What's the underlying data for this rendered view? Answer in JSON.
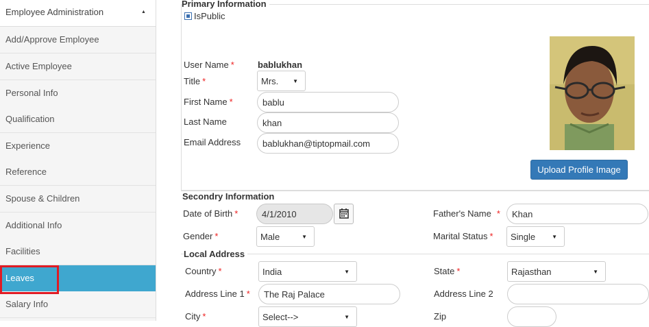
{
  "sidebar": {
    "header": "Employee Administration",
    "items": [
      {
        "label": "Add/Approve Employee"
      },
      {
        "label": "Active Employee"
      },
      {
        "label": "Personal Info"
      },
      {
        "label": "Qualification"
      },
      {
        "label": "Experience"
      },
      {
        "label": "Reference"
      },
      {
        "label": "Spouse & Children"
      },
      {
        "label": "Additional Info"
      },
      {
        "label": "Facilities"
      },
      {
        "label": "Leaves"
      },
      {
        "label": "Salary Info"
      }
    ],
    "active_item": "Leaves",
    "active_color": "#3fa7cf",
    "highlight_color": "#e01b24"
  },
  "primary": {
    "legend": "Primary Information",
    "is_public_label": "IsPublic",
    "is_public_checked": true,
    "username_label": "User Name",
    "username_value": "bablukhan",
    "title_label": "Title",
    "title_value": "Mrs.",
    "first_name_label": "First Name",
    "first_name_value": "bablu",
    "last_name_label": "Last Name",
    "last_name_value": "khan",
    "email_label": "Email Address",
    "email_value": "bablukhan@tiptopmail.com",
    "upload_button": "Upload Profile Image"
  },
  "secondary": {
    "legend": "Secondry Information",
    "dob_label": "Date of Birth",
    "dob_value": "4/1/2010",
    "father_label": "Father's Name",
    "father_value": "Khan",
    "gender_label": "Gender",
    "gender_value": "Male",
    "marital_label": "Marital Status",
    "marital_value": "Single"
  },
  "local_address": {
    "legend": "Local Address",
    "country_label": "Country",
    "country_value": "India",
    "state_label": "State",
    "state_value": "Rajasthan",
    "address1_label": "Address Line 1",
    "address1_value": "The Raj Palace",
    "address2_label": "Address Line 2",
    "address2_value": "",
    "city_label": "City",
    "city_value": "Select-->",
    "zip_label": "Zip",
    "zip_value": ""
  },
  "required_marker": "*",
  "colors": {
    "upload_button": "#3479b7",
    "required": "#ee2222"
  }
}
